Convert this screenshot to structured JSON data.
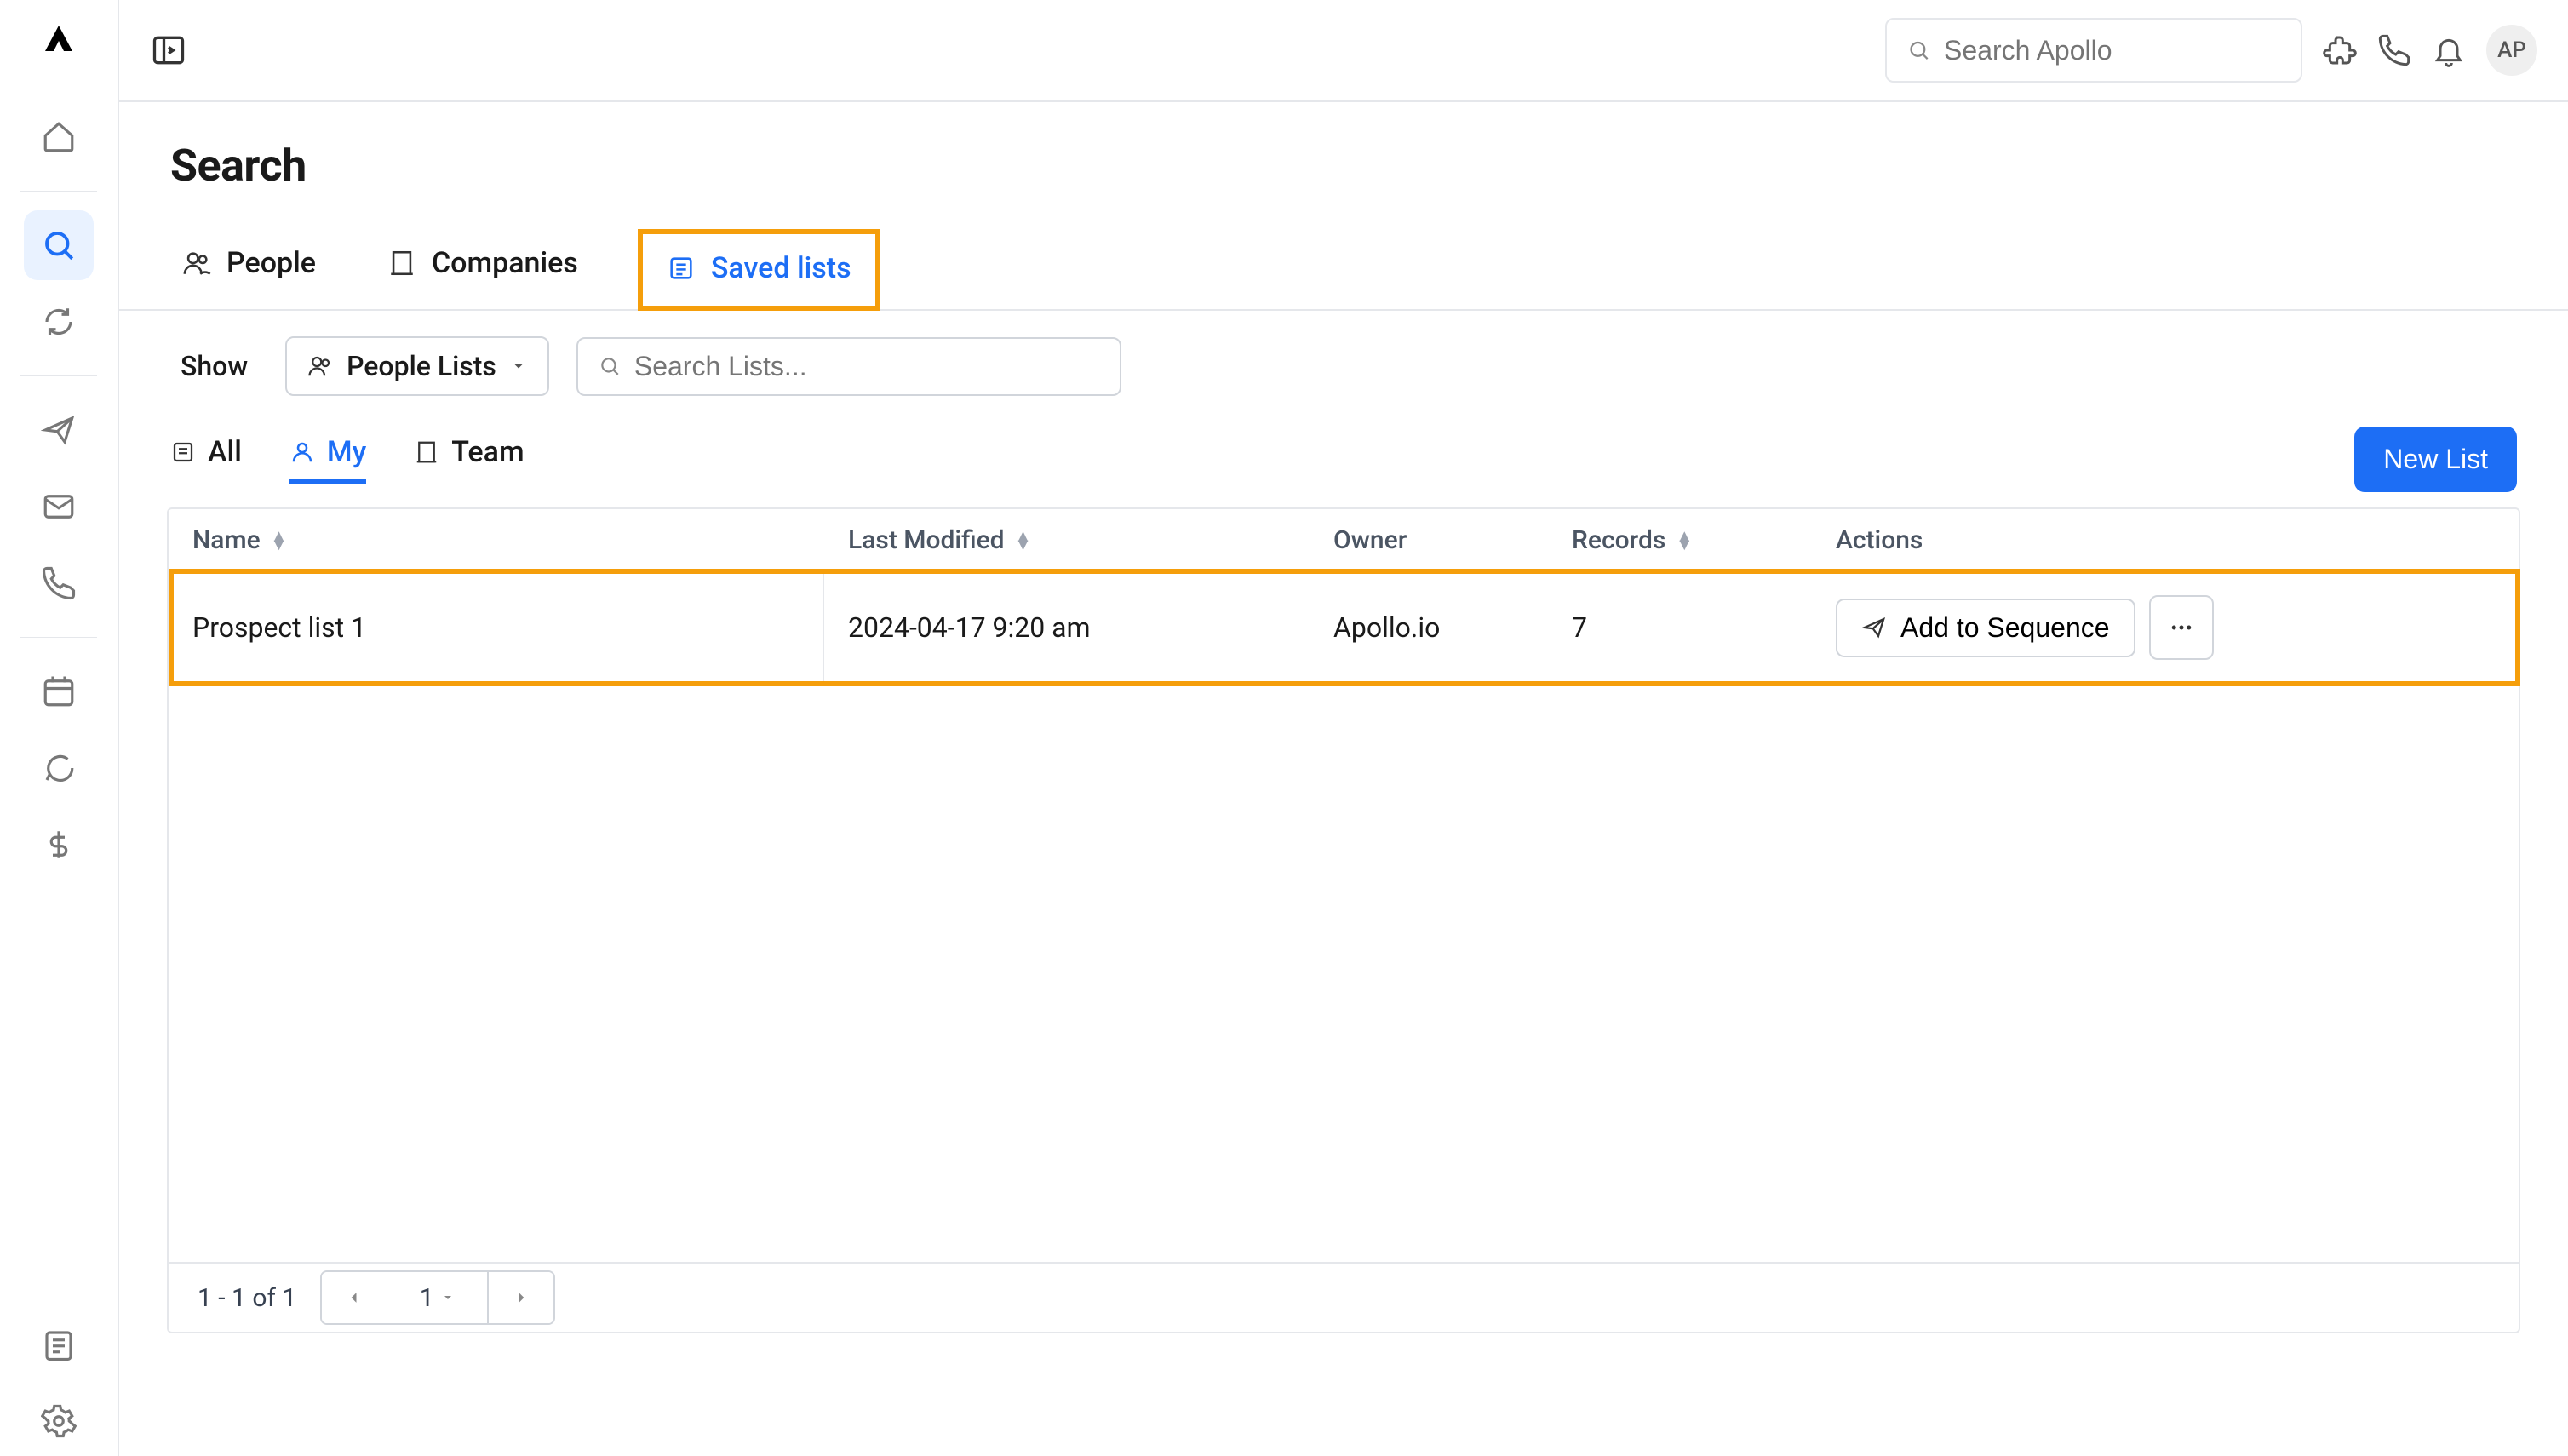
{
  "topbar": {
    "search_placeholder": "Search Apollo",
    "avatar_initials": "AP"
  },
  "page": {
    "title": "Search"
  },
  "tabs": {
    "people": "People",
    "companies": "Companies",
    "saved_lists": "Saved lists"
  },
  "toolbar": {
    "show_label": "Show",
    "list_type": "People Lists",
    "search_placeholder": "Search Lists..."
  },
  "subtabs": {
    "all": "All",
    "my": "My",
    "team": "Team"
  },
  "buttons": {
    "new_list": "New List",
    "add_to_sequence": "Add to Sequence"
  },
  "columns": {
    "name": "Name",
    "last_modified": "Last Modified",
    "owner": "Owner",
    "records": "Records",
    "actions": "Actions"
  },
  "rows": [
    {
      "name": "Prospect list 1",
      "last_modified": "2024-04-17 9:20 am",
      "owner": "Apollo.io",
      "records": "7"
    }
  ],
  "pagination": {
    "range": "1 - 1 of 1",
    "page": "1"
  }
}
